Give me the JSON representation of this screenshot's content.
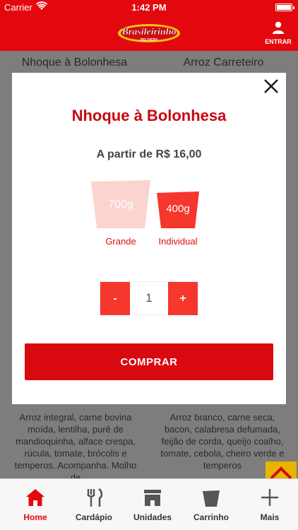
{
  "status_bar": {
    "carrier": "Carrier",
    "time": "1:42 PM"
  },
  "header": {
    "logo_text": "Brasileirinho",
    "logo_sub": "DELIVERY",
    "login_label": "ENTRAR"
  },
  "background": {
    "left_title": "Nhoque à Bolonhesa",
    "right_title": "Arroz Carreteiro",
    "left_desc": "Arroz integral, carne bovina moída, lentilha, purê de mandioquinha, alface crespa, rúcula, tomate, brócolis e temperos. Acompanha. Molho de",
    "right_desc": "Arroz branco, carne seca, bacon, calabresa defumada, feijão de corda, queijo coalho, tomate, cebola, cheiro verde e temperos"
  },
  "modal": {
    "title": "Nhoque à Bolonhesa",
    "price_text": "A partir de R$ 16,00",
    "sizes": [
      {
        "weight": "700g",
        "label": "Grande",
        "selected": false
      },
      {
        "weight": "400g",
        "label": "Individual",
        "selected": true
      }
    ],
    "stepper": {
      "minus": "-",
      "quantity": "1",
      "plus": "+"
    },
    "buy_label": "COMPRAR"
  },
  "tabs": [
    {
      "label": "Home",
      "icon": "home-icon",
      "active": true
    },
    {
      "label": "Cardápio",
      "icon": "cutlery-icon",
      "active": false
    },
    {
      "label": "Unidades",
      "icon": "store-icon",
      "active": false
    },
    {
      "label": "Carrinho",
      "icon": "cup-icon",
      "active": false
    },
    {
      "label": "Mais",
      "icon": "plus-icon",
      "active": false
    }
  ],
  "colors": {
    "brand_red": "#e3080d",
    "button_red": "#d8090f",
    "stepper_red": "#f5372e",
    "size_light": "#fbd3cf",
    "size_active": "#f5372e"
  }
}
